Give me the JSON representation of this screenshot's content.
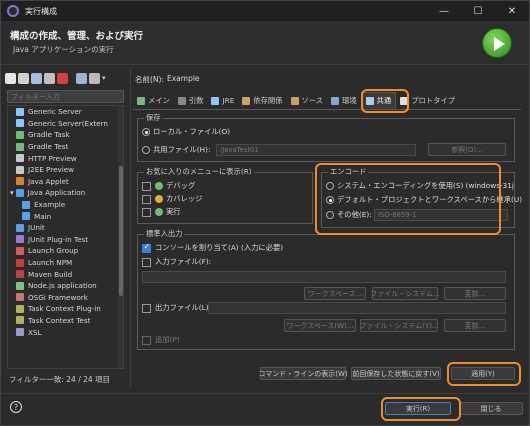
{
  "window": {
    "title": "実行構成"
  },
  "header": {
    "title": "構成の作成、管理、および実行",
    "subtitle": "Java アプリケーションの実行"
  },
  "filter": {
    "placeholder": "フィルター入力"
  },
  "tree": {
    "items": [
      {
        "label": "Generic Server",
        "color": "#8ec5ff",
        "indent": 1
      },
      {
        "label": "Generic Server(Extern",
        "color": "#8ec5ff",
        "indent": 1
      },
      {
        "label": "Gradle Task",
        "color": "#6fbf73",
        "indent": 1
      },
      {
        "label": "Gradle Test",
        "color": "#6fbf73",
        "indent": 1
      },
      {
        "label": "HTTP Preview",
        "color": "#c8c8c8",
        "indent": 1
      },
      {
        "label": "J2EE Preview",
        "color": "#c8c8c8",
        "indent": 1
      },
      {
        "label": "Java Applet",
        "color": "#d9822b",
        "indent": 1
      },
      {
        "label": "Java Application",
        "color": "#5aa0e6",
        "indent": 0
      },
      {
        "label": "Example",
        "color": "#5aa0e6",
        "indent": 2
      },
      {
        "label": "Main",
        "color": "#5aa0e6",
        "indent": 2
      },
      {
        "label": "JUnit",
        "color": "#5aa0e6",
        "indent": 1
      },
      {
        "label": "JUnit Plug-in Test",
        "color": "#9b7bd1",
        "indent": 1
      },
      {
        "label": "Launch Group",
        "color": "#d06060",
        "indent": 1
      },
      {
        "label": "Launch NPM",
        "color": "#c04040",
        "indent": 1
      },
      {
        "label": "Maven Build",
        "color": "#c04040",
        "indent": 1
      },
      {
        "label": "Node.js application",
        "color": "#7cc27c",
        "indent": 1
      },
      {
        "label": "OSGi Framework",
        "color": "#c07878",
        "indent": 1
      },
      {
        "label": "Task Context Plug-in",
        "color": "#b0b060",
        "indent": 1
      },
      {
        "label": "Task Context Test",
        "color": "#b0b060",
        "indent": 1
      },
      {
        "label": "XSL",
        "color": "#9999cc",
        "indent": 1
      }
    ]
  },
  "filter_status": "フィルター一致: 24 / 24 項目",
  "name": {
    "label": "名前(N):",
    "value": "Example"
  },
  "tabs": [
    {
      "label": "メイン",
      "color": "#6fbf73",
      "active": false
    },
    {
      "label": "引数",
      "color": "#888888",
      "active": false
    },
    {
      "label": "JRE",
      "color": "#8ec5ff",
      "active": false
    },
    {
      "label": "依存関係",
      "color": "#d0a060",
      "active": false
    },
    {
      "label": "ソース",
      "color": "#c8a060",
      "active": false
    },
    {
      "label": "環境",
      "color": "#7fa8d8",
      "active": false
    },
    {
      "label": "共通",
      "color": "#aaccee",
      "active": true
    },
    {
      "label": "プロトタイプ",
      "color": "#dddddd",
      "active": false
    }
  ],
  "save": {
    "title": "保存",
    "local": "ローカル・ファイル(O)",
    "shared": "共用ファイル(H):",
    "shared_value": "/JavaTest01",
    "browse": "参照(O)..."
  },
  "favorites": {
    "title": "お気に入りのメニューに表示(R)",
    "items": [
      "デバッグ",
      "カバレッジ",
      "実行"
    ]
  },
  "encoding": {
    "title": "エンコード",
    "system": "システム・エンコーディングを使用(S) (windows-31j",
    "default": "デフォルト・プロジェクトとワークスペースから継承(U)",
    "other": "その他(E):",
    "other_value": "ISO-8859-1"
  },
  "stdio": {
    "title": "標準入出力",
    "alloc": "コンソールを割り当て(A) (入力に必要)",
    "input": "入力ファイル(F):",
    "output": "出力ファイル(L):",
    "append": "追加(P)",
    "workspace": "ワークスペース...",
    "filesystem": "ファイル・システム...",
    "variables": "変数...",
    "workspace2": "ワークスペース(W)...",
    "filesystem2": "ファイル・システム(Y)...",
    "variables2": "変数..."
  },
  "buttons": {
    "cmdline": "コマンド・ラインの表示(W)",
    "revert": "前回保存した状態に戻す(V)",
    "apply": "適用(Y)",
    "run": "実行(R)",
    "close": "閉じる"
  },
  "colors": {
    "highlight": "#f28c28",
    "accent": "#3b7ddd"
  }
}
